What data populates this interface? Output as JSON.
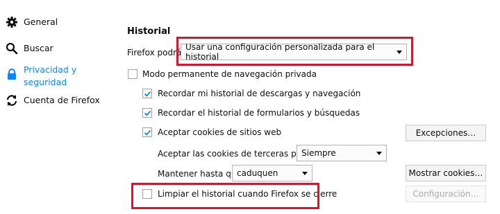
{
  "sidebar": {
    "items": [
      {
        "label": "General",
        "icon": "gear-icon"
      },
      {
        "label": "Buscar",
        "icon": "search-icon"
      },
      {
        "label": "Privacidad y seguridad",
        "icon": "lock-icon",
        "selected": true
      },
      {
        "label": "Cuenta de Firefox",
        "icon": "sync-icon"
      }
    ]
  },
  "history": {
    "heading": "Historial",
    "firefox_label": "Firefox podrá",
    "mode_value": "Usar una configuración personalizada para el historial",
    "private_mode": {
      "label": "Modo permanente de navegación privada",
      "checked": false
    },
    "remember_downloads": {
      "label": "Recordar mi historial de descargas y navegación",
      "checked": true
    },
    "remember_forms": {
      "label": "Recordar el historial de formularios y búsquedas",
      "checked": true
    },
    "accept_cookies": {
      "label": "Aceptar cookies de sitios web",
      "checked": true
    },
    "third_party_label": "Aceptar las cookies de terceras partes",
    "third_party_value": "Siempre",
    "keep_until_label": "Mantener hasta que",
    "keep_until_value": "caduquen",
    "clear_history": {
      "label": "Limpiar el historial cuando Firefox se cierre",
      "checked": false
    },
    "exceptions_button": "Excepciones…",
    "show_cookies_button": "Mostrar cookies…",
    "settings_button": "Configuración…"
  },
  "colors": {
    "accent": "#0a84ff",
    "highlight": "#d3162b"
  }
}
